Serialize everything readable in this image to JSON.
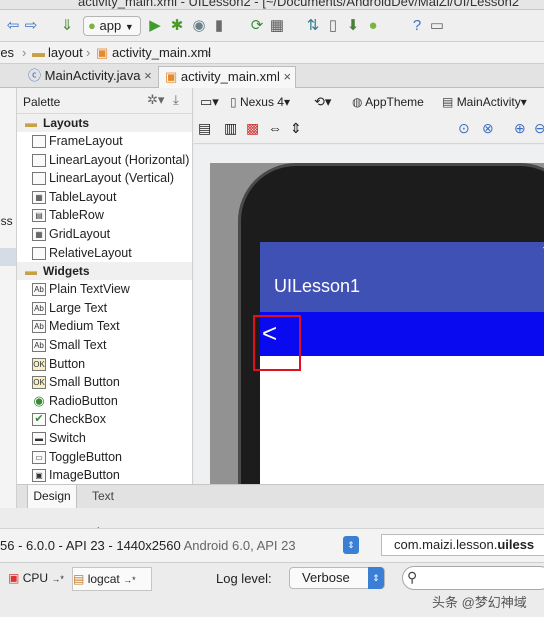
{
  "window_title": "activity_main.xml - UILesson2 - [~/Documents/AndroidDev/MaiZi/UI/Lesson2",
  "toolbar": {
    "run_config": "app"
  },
  "breadcrumb": {
    "first": "res",
    "second": "layout",
    "third": "activity_main.xml"
  },
  "editor_tabs": [
    {
      "label": "MainActivity.java",
      "close": "×"
    },
    {
      "label": "activity_main.xml",
      "close": "×"
    }
  ],
  "left_strip": {
    "fragment": "ess"
  },
  "palette": {
    "title": "Palette",
    "categories": [
      {
        "label": "Layouts",
        "items": [
          {
            "label": "FrameLayout",
            "icon": "frame-layout-icon"
          },
          {
            "label": "LinearLayout (Horizontal)",
            "icon": "linear-horizontal-icon"
          },
          {
            "label": "LinearLayout (Vertical)",
            "icon": "linear-vertical-icon"
          },
          {
            "label": "TableLayout",
            "icon": "table-layout-icon"
          },
          {
            "label": "TableRow",
            "icon": "table-row-icon"
          },
          {
            "label": "GridLayout",
            "icon": "grid-layout-icon"
          },
          {
            "label": "RelativeLayout",
            "icon": "relative-layout-icon"
          }
        ]
      },
      {
        "label": "Widgets",
        "items": [
          {
            "label": "Plain TextView",
            "icon": "textview-icon"
          },
          {
            "label": "Large Text",
            "icon": "large-text-icon"
          },
          {
            "label": "Medium Text",
            "icon": "medium-text-icon"
          },
          {
            "label": "Small Text",
            "icon": "small-text-icon"
          },
          {
            "label": "Button",
            "icon": "button-icon"
          },
          {
            "label": "Small Button",
            "icon": "small-button-icon"
          },
          {
            "label": "RadioButton",
            "icon": "radio-button-icon"
          },
          {
            "label": "CheckBox",
            "icon": "checkbox-icon"
          },
          {
            "label": "Switch",
            "icon": "switch-icon"
          },
          {
            "label": "ToggleButton",
            "icon": "toggle-button-icon"
          },
          {
            "label": "ImageButton",
            "icon": "image-button-icon"
          }
        ]
      }
    ]
  },
  "canvas_toolbar": {
    "device": "Nexus 4",
    "theme": "AppTheme",
    "activity": "MainActivity"
  },
  "preview": {
    "app_title": "UILesson1",
    "back_glyph": "<"
  },
  "design_tabs": {
    "design": "Design",
    "text": "Text"
  },
  "device_bar": {
    "device_text": "56 - 6.0.0 - API 23 - 1440x2560",
    "device_extra": "Android 6.0, API 23",
    "package_prefix": "com.maizi.lesson.",
    "package_bold": "uiless"
  },
  "logcat_bar": {
    "cpu_tab": "CPU",
    "logcat_tab": "logcat",
    "log_level_label": "Log level:",
    "log_level_value": "Verbose"
  },
  "watermark": "头条 @梦幻神域",
  "colors": {
    "app_bar": "#3f51b5",
    "blue_bar": "#0a0af0",
    "highlight": "#e0101e",
    "accent": "#3a7fd5"
  }
}
